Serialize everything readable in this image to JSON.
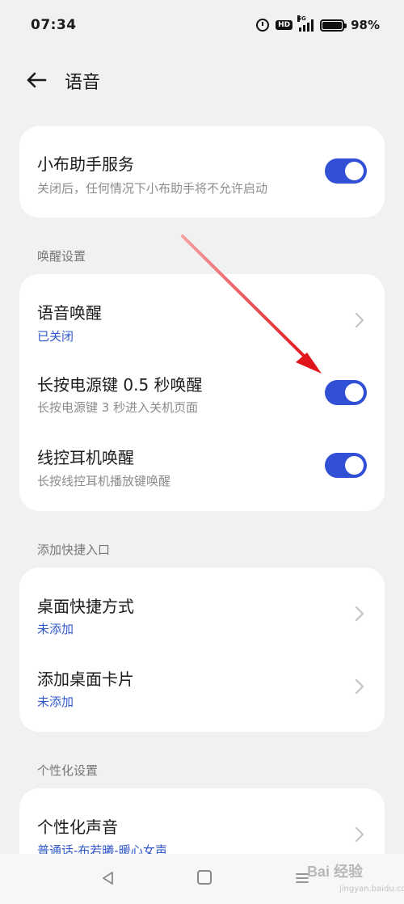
{
  "status_bar": {
    "time": "07:34",
    "hd_label": "HD",
    "network_label": "5G",
    "battery_percent": "98%",
    "battery_level": 0.98
  },
  "header": {
    "title": "语音",
    "back_icon": "arrow-left-icon"
  },
  "assistant_card": {
    "title": "小布助手服务",
    "subtitle": "关闭后，任何情况下小布助手将不允许启动",
    "enabled": true
  },
  "wake_section": {
    "title": "唤醒设置",
    "items": [
      {
        "title": "语音唤醒",
        "subtitle": "已关闭",
        "control": "chevron"
      },
      {
        "title": "长按电源键 0.5 秒唤醒",
        "subtitle": "长按电源键 3 秒进入关机页面",
        "control": "toggle",
        "enabled": true
      },
      {
        "title": "线控耳机唤醒",
        "subtitle": "长按线控耳机播放键唤醒",
        "control": "toggle",
        "enabled": true
      }
    ]
  },
  "shortcut_section": {
    "title": "添加快捷入口",
    "items": [
      {
        "title": "桌面快捷方式",
        "subtitle": "未添加",
        "control": "chevron"
      },
      {
        "title": "添加桌面卡片",
        "subtitle": "未添加",
        "control": "chevron"
      }
    ]
  },
  "personalize_section": {
    "title": "个性化设置",
    "items": [
      {
        "title": "个性化声音",
        "subtitle": "普通话-布若曦-暖心女声",
        "control": "chevron"
      }
    ]
  },
  "nav_bar": {
    "back_icon": "triangle-back-icon",
    "home_icon": "square-home-icon",
    "recent_icon": "recent-apps-icon"
  },
  "watermark": {
    "text": "Bai 经验",
    "sub": "jingyan.baidu.com"
  },
  "colors": {
    "accent": "#3150d6",
    "link": "#3158c9",
    "background": "#f1f1f2",
    "annotation": "#e0141b"
  }
}
